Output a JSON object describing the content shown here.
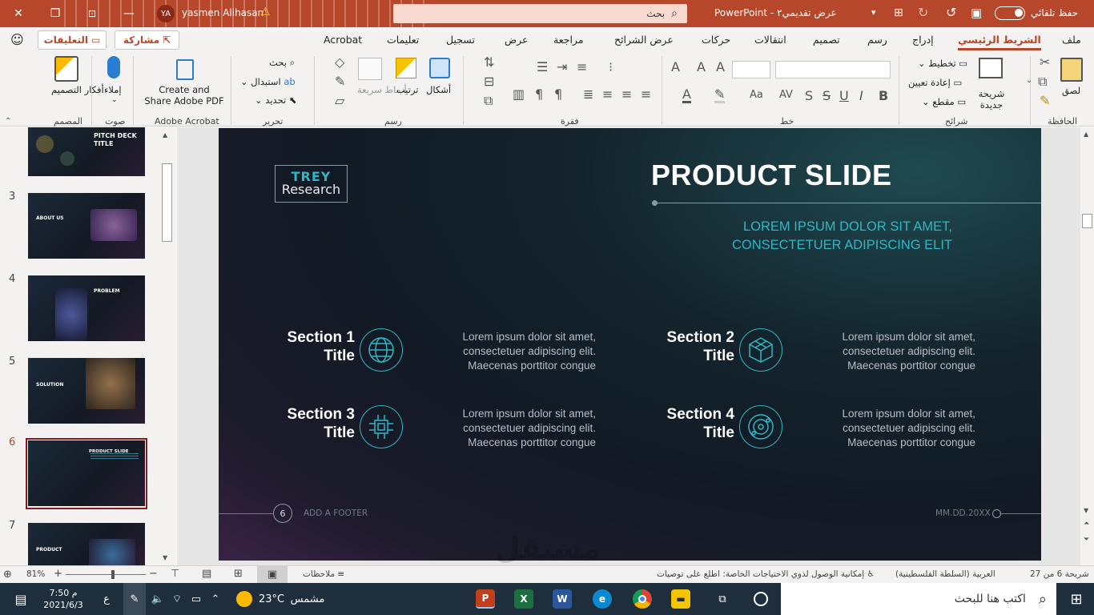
{
  "titlebar": {
    "autosave_label": "حفظ تلقائي",
    "doc_title": "عرض تقديمي٢",
    "app_name": "PowerPoint",
    "separator": "-",
    "search_placeholder": "بحث",
    "user_name": "yasmen Alihasan",
    "user_initials": "YA"
  },
  "tabs": [
    "ملف",
    "الشريط الرئيسي",
    "إدراج",
    "رسم",
    "تصميم",
    "انتقالات",
    "حركات",
    "عرض الشرائح",
    "مراجعة",
    "عرض",
    "تسجيل",
    "تعليمات",
    "Acrobat"
  ],
  "active_tab": "الشريط الرئيسي",
  "share": {
    "share_label": "مشاركة",
    "comments_label": "التعليقات"
  },
  "ribbon": {
    "clipboard": {
      "label": "الحافظة",
      "paste": "لصق"
    },
    "slides": {
      "label": "شرائح",
      "new_slide": "شريحة جديدة",
      "layout": "تخطيط",
      "reset": "إعادة تعيين",
      "section": "مقطع"
    },
    "font": {
      "label": "خط"
    },
    "paragraph": {
      "label": "فقرة"
    },
    "drawing": {
      "label": "رسم",
      "shapes": "أشكال",
      "arrange": "ترتيب",
      "quick_styles": "أنماط سريعة"
    },
    "editing": {
      "label": "تحرير",
      "find": "بحث",
      "replace": "استبدال",
      "select": "تحديد"
    },
    "adobe": {
      "label": "Adobe Acrobat",
      "create_share": "Create and Share Adobe PDF"
    },
    "voice": {
      "label": "صوت",
      "dictate": "إملاء"
    },
    "designer": {
      "label": "المصمم",
      "ideas": "أفكار التصميم"
    }
  },
  "slides_panel": {
    "thumbs": [
      {
        "num": "",
        "title": "PITCH DECK TITLE"
      },
      {
        "num": "3",
        "title": "ABOUT US"
      },
      {
        "num": "4",
        "title": "PROBLEM"
      },
      {
        "num": "5",
        "title": "SOLUTION"
      },
      {
        "num": "6",
        "title": "PRODUCT SLIDE"
      },
      {
        "num": "7",
        "title": "PRODUCT"
      }
    ]
  },
  "slide": {
    "logo_line1": "TREY",
    "logo_line2": "Research",
    "title": "PRODUCT SLIDE",
    "subtitle_line1": "LOREM IPSUM DOLOR SIT AMET,",
    "subtitle_line2": "CONSECTETUER ADIPISCING ELIT",
    "sections": [
      {
        "title_line1": "Section 1",
        "title_line2": "Title",
        "icon": "globe-icon",
        "body": [
          "Lorem ipsum dolor sit amet,",
          "consectetuer adipiscing elit.",
          "Maecenas porttitor congue"
        ]
      },
      {
        "title_line1": "Section 2",
        "title_line2": "Title",
        "icon": "network-icon",
        "body": [
          "Lorem ipsum dolor sit amet,",
          "consectetuer adipiscing elit.",
          "Maecenas porttitor congue"
        ]
      },
      {
        "title_line1": "Section 3",
        "title_line2": "Title",
        "icon": "chip-icon",
        "body": [
          "Lorem ipsum dolor sit amet,",
          "consectetuer adipiscing elit.",
          "Maecenas porttitor congue"
        ]
      },
      {
        "title_line1": "Section 4",
        "title_line2": "Title",
        "icon": "orbit-icon",
        "body": [
          "Lorem ipsum dolor sit amet,",
          "consectetuer adipiscing elit.",
          "Maecenas porttitor congue"
        ]
      }
    ],
    "footer_number": "6",
    "footer_text": "ADD A FOOTER",
    "footer_date": "MM.DD.20XX",
    "accent_color": "#2fb7c5"
  },
  "statusbar": {
    "slide_info": "شريحة 6 من 27",
    "language": "العربية (السلطة الفلسطينية)",
    "accessibility": "إمكانية الوصول لذوي الاحتياجات الخاصة: اطلع على توصيات",
    "notes_label": "ملاحظات",
    "zoom": "81%"
  },
  "taskbar": {
    "search_placeholder": "اكتب هنا للبحث",
    "weather_label": "مشمس",
    "temperature": "23°C",
    "time": "7:50 م",
    "date": "2021/6/3",
    "lang": "ع"
  },
  "watermark": {
    "text1": "مستقل",
    "text2": "mostaql.com"
  }
}
